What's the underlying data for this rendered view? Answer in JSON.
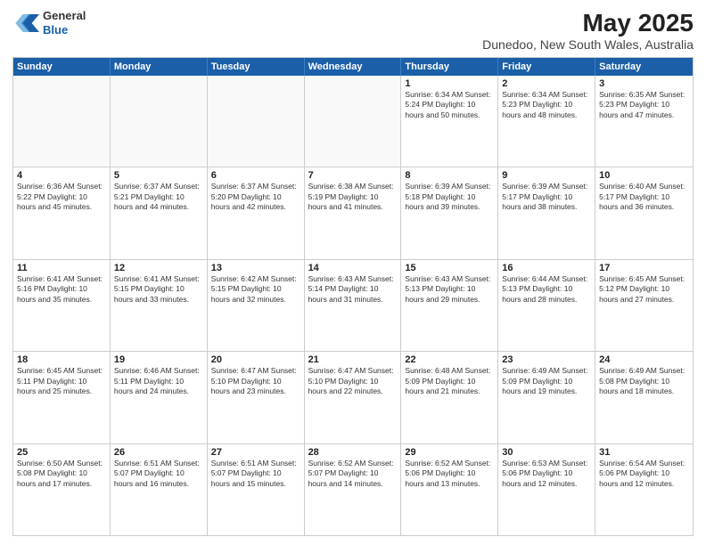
{
  "header": {
    "logo": {
      "line1": "General",
      "line2": "Blue"
    },
    "title": "May 2025",
    "subtitle": "Dunedoo, New South Wales, Australia"
  },
  "weekdays": [
    "Sunday",
    "Monday",
    "Tuesday",
    "Wednesday",
    "Thursday",
    "Friday",
    "Saturday"
  ],
  "rows": [
    [
      {
        "day": "",
        "info": "",
        "empty": true
      },
      {
        "day": "",
        "info": "",
        "empty": true
      },
      {
        "day": "",
        "info": "",
        "empty": true
      },
      {
        "day": "",
        "info": "",
        "empty": true
      },
      {
        "day": "1",
        "info": "Sunrise: 6:34 AM\nSunset: 5:24 PM\nDaylight: 10 hours\nand 50 minutes."
      },
      {
        "day": "2",
        "info": "Sunrise: 6:34 AM\nSunset: 5:23 PM\nDaylight: 10 hours\nand 48 minutes."
      },
      {
        "day": "3",
        "info": "Sunrise: 6:35 AM\nSunset: 5:23 PM\nDaylight: 10 hours\nand 47 minutes."
      }
    ],
    [
      {
        "day": "4",
        "info": "Sunrise: 6:36 AM\nSunset: 5:22 PM\nDaylight: 10 hours\nand 45 minutes."
      },
      {
        "day": "5",
        "info": "Sunrise: 6:37 AM\nSunset: 5:21 PM\nDaylight: 10 hours\nand 44 minutes."
      },
      {
        "day": "6",
        "info": "Sunrise: 6:37 AM\nSunset: 5:20 PM\nDaylight: 10 hours\nand 42 minutes."
      },
      {
        "day": "7",
        "info": "Sunrise: 6:38 AM\nSunset: 5:19 PM\nDaylight: 10 hours\nand 41 minutes."
      },
      {
        "day": "8",
        "info": "Sunrise: 6:39 AM\nSunset: 5:18 PM\nDaylight: 10 hours\nand 39 minutes."
      },
      {
        "day": "9",
        "info": "Sunrise: 6:39 AM\nSunset: 5:17 PM\nDaylight: 10 hours\nand 38 minutes."
      },
      {
        "day": "10",
        "info": "Sunrise: 6:40 AM\nSunset: 5:17 PM\nDaylight: 10 hours\nand 36 minutes."
      }
    ],
    [
      {
        "day": "11",
        "info": "Sunrise: 6:41 AM\nSunset: 5:16 PM\nDaylight: 10 hours\nand 35 minutes."
      },
      {
        "day": "12",
        "info": "Sunrise: 6:41 AM\nSunset: 5:15 PM\nDaylight: 10 hours\nand 33 minutes."
      },
      {
        "day": "13",
        "info": "Sunrise: 6:42 AM\nSunset: 5:15 PM\nDaylight: 10 hours\nand 32 minutes."
      },
      {
        "day": "14",
        "info": "Sunrise: 6:43 AM\nSunset: 5:14 PM\nDaylight: 10 hours\nand 31 minutes."
      },
      {
        "day": "15",
        "info": "Sunrise: 6:43 AM\nSunset: 5:13 PM\nDaylight: 10 hours\nand 29 minutes."
      },
      {
        "day": "16",
        "info": "Sunrise: 6:44 AM\nSunset: 5:13 PM\nDaylight: 10 hours\nand 28 minutes."
      },
      {
        "day": "17",
        "info": "Sunrise: 6:45 AM\nSunset: 5:12 PM\nDaylight: 10 hours\nand 27 minutes."
      }
    ],
    [
      {
        "day": "18",
        "info": "Sunrise: 6:45 AM\nSunset: 5:11 PM\nDaylight: 10 hours\nand 25 minutes."
      },
      {
        "day": "19",
        "info": "Sunrise: 6:46 AM\nSunset: 5:11 PM\nDaylight: 10 hours\nand 24 minutes."
      },
      {
        "day": "20",
        "info": "Sunrise: 6:47 AM\nSunset: 5:10 PM\nDaylight: 10 hours\nand 23 minutes."
      },
      {
        "day": "21",
        "info": "Sunrise: 6:47 AM\nSunset: 5:10 PM\nDaylight: 10 hours\nand 22 minutes."
      },
      {
        "day": "22",
        "info": "Sunrise: 6:48 AM\nSunset: 5:09 PM\nDaylight: 10 hours\nand 21 minutes."
      },
      {
        "day": "23",
        "info": "Sunrise: 6:49 AM\nSunset: 5:09 PM\nDaylight: 10 hours\nand 19 minutes."
      },
      {
        "day": "24",
        "info": "Sunrise: 6:49 AM\nSunset: 5:08 PM\nDaylight: 10 hours\nand 18 minutes."
      }
    ],
    [
      {
        "day": "25",
        "info": "Sunrise: 6:50 AM\nSunset: 5:08 PM\nDaylight: 10 hours\nand 17 minutes."
      },
      {
        "day": "26",
        "info": "Sunrise: 6:51 AM\nSunset: 5:07 PM\nDaylight: 10 hours\nand 16 minutes."
      },
      {
        "day": "27",
        "info": "Sunrise: 6:51 AM\nSunset: 5:07 PM\nDaylight: 10 hours\nand 15 minutes."
      },
      {
        "day": "28",
        "info": "Sunrise: 6:52 AM\nSunset: 5:07 PM\nDaylight: 10 hours\nand 14 minutes."
      },
      {
        "day": "29",
        "info": "Sunrise: 6:52 AM\nSunset: 5:06 PM\nDaylight: 10 hours\nand 13 minutes."
      },
      {
        "day": "30",
        "info": "Sunrise: 6:53 AM\nSunset: 5:06 PM\nDaylight: 10 hours\nand 12 minutes."
      },
      {
        "day": "31",
        "info": "Sunrise: 6:54 AM\nSunset: 5:06 PM\nDaylight: 10 hours\nand 12 minutes."
      }
    ]
  ]
}
